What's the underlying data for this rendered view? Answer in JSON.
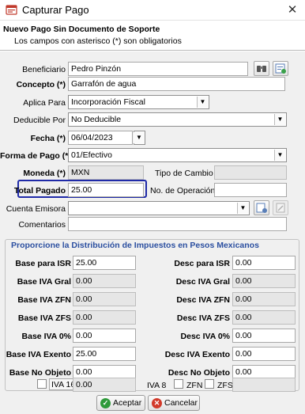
{
  "window": {
    "title": "Capturar Pago",
    "close_glyph": "✕"
  },
  "header": {
    "title": "Nuevo Pago Sin Documento de Soporte",
    "subtitle": "Los campos con asterisco (*) son obligatorios"
  },
  "form": {
    "beneficiario": {
      "label": "Beneficiario",
      "value": "Pedro Pinzón"
    },
    "concepto": {
      "label": "Concepto (*)",
      "value": "Garrafón de agua"
    },
    "aplica_para": {
      "label": "Aplica Para",
      "value": "Incorporación Fiscal"
    },
    "deducible_por": {
      "label": "Deducible Por",
      "value": "No Deducible"
    },
    "fecha": {
      "label": "Fecha (*)",
      "value": "06/04/2023"
    },
    "forma_pago": {
      "label": "Forma de Pago (*)",
      "value": "01/Efectivo"
    },
    "moneda": {
      "label": "Moneda (*)",
      "value": "MXN"
    },
    "tipo_cambio": {
      "label": "Tipo de Cambio",
      "value": ""
    },
    "total_pagado": {
      "label": "Total Pagado",
      "value": "25.00"
    },
    "no_operacion": {
      "label": "No. de Operación",
      "value": ""
    },
    "cuenta_emisora": {
      "label": "Cuenta Emisora",
      "value": ""
    },
    "comentarios": {
      "label": "Comentarios",
      "value": ""
    }
  },
  "taxes": {
    "title": "Proporcione la Distribución de Impuestos en Pesos Mexicanos",
    "left": [
      {
        "label": "Base para ISR",
        "value": "25.00"
      },
      {
        "label": "Base IVA Gral",
        "value": "0.00"
      },
      {
        "label": "Base IVA ZFN",
        "value": "0.00"
      },
      {
        "label": "Base IVA ZFS",
        "value": "0.00"
      },
      {
        "label": "Base IVA 0%",
        "value": "0.00"
      },
      {
        "label": "Base IVA Exento",
        "value": "25.00"
      },
      {
        "label": "Base No Objeto",
        "value": "0.00"
      }
    ],
    "right": [
      {
        "label": "Desc para ISR",
        "value": "0.00"
      },
      {
        "label": "Desc IVA Gral",
        "value": "0.00"
      },
      {
        "label": "Desc IVA ZFN",
        "value": "0.00"
      },
      {
        "label": "Desc IVA ZFS",
        "value": "0.00"
      },
      {
        "label": "Desc IVA 0%",
        "value": "0.00"
      },
      {
        "label": "Desc IVA Exento",
        "value": "0.00"
      },
      {
        "label": "Desc No Objeto",
        "value": "0.00"
      }
    ],
    "iva16": {
      "label": "IVA 16",
      "value": "0.00",
      "checked": false
    },
    "iva8": {
      "label": "IVA 8"
    },
    "zfn": {
      "label": "ZFN",
      "checked": false
    },
    "zfs": {
      "label": "ZFS",
      "checked": false
    }
  },
  "buttons": {
    "accept": "Aceptar",
    "cancel": "Cancelar"
  },
  "colors": {
    "highlight": "#1f2aa8",
    "group_title": "#2b4fa0",
    "accept_icon": "#2e9a3a",
    "cancel_icon": "#d23a2a"
  },
  "icons": {
    "binoculars": "binoculars-icon",
    "add_contact": "add-contact-icon",
    "new_account": "new-account-icon",
    "edit_account": "edit-account-icon"
  }
}
